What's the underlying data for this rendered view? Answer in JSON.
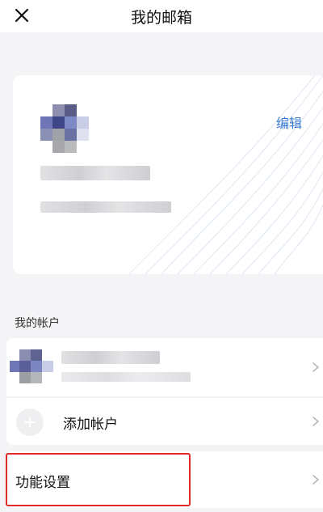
{
  "header": {
    "title": "我的邮箱",
    "close_icon": "close-icon"
  },
  "profile_card": {
    "edit_label": "编辑",
    "accent_color": "#3b7bd8"
  },
  "accounts_section": {
    "label": "我的帐户"
  },
  "add_account": {
    "label": "添加帐户",
    "icon": "plus-icon"
  },
  "function_settings": {
    "label": "功能设置",
    "highlight_color": "#e02a2a"
  }
}
